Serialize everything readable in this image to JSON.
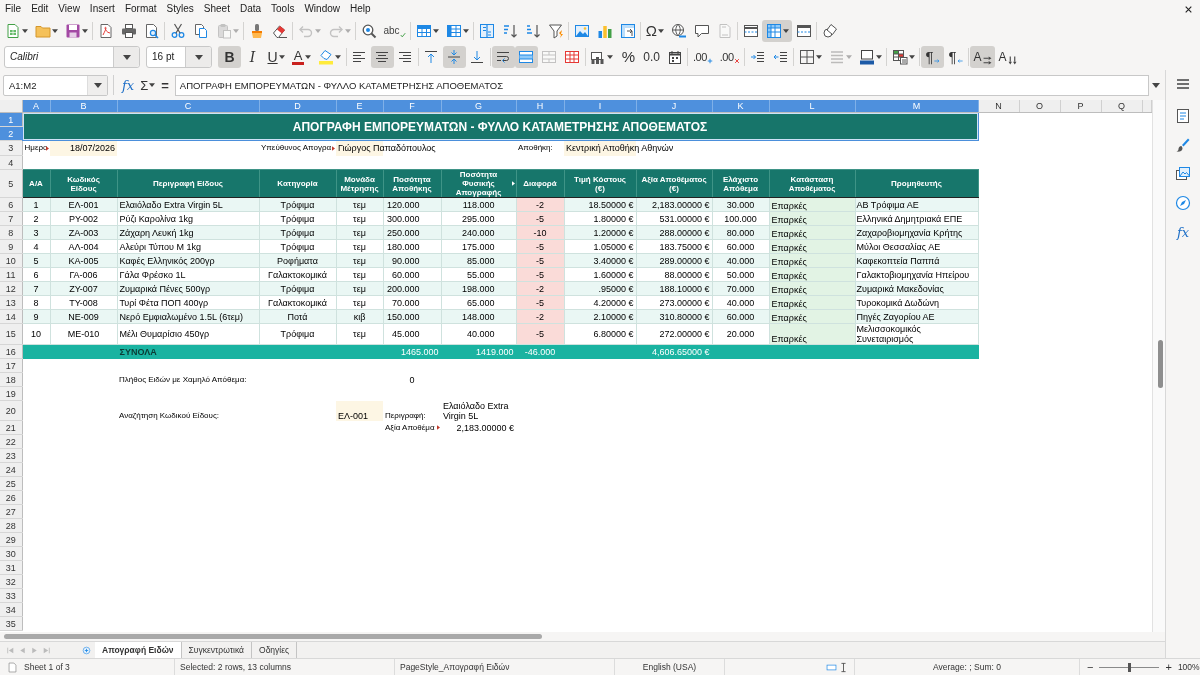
{
  "menu_bar": [
    "File",
    "Edit",
    "View",
    "Insert",
    "Format",
    "Styles",
    "Sheet",
    "Data",
    "Tools",
    "Window",
    "Help"
  ],
  "standard_toolbar": {
    "paste": {
      "disabled": true
    },
    "undo": {
      "disabled": true
    },
    "redo": {
      "disabled": true
    },
    "spelling": {
      "label": "abc"
    },
    "special_character": {
      "label": "Ω"
    },
    "header_footer": {
      "disabled": true
    },
    "freeze_rows_columns": {
      "pressed": true
    }
  },
  "formatting_toolbar": {
    "font_name": "Calibri",
    "font_size": "16 pt",
    "bold": {
      "label": "B",
      "pressed": true
    },
    "italic": {
      "label": "I",
      "pressed": false
    },
    "underline": {
      "label": "U",
      "pressed": false
    },
    "font_color": {
      "label": "A"
    },
    "align_left": {
      "pressed": false
    },
    "align_center": {
      "pressed": true
    },
    "align_right": {
      "pressed": false
    },
    "align_top": {
      "pressed": false
    },
    "align_middle": {
      "pressed": true
    },
    "align_bottom": {
      "pressed": false
    },
    "wrap_text": {
      "pressed": true
    },
    "merge_and_center": {
      "pressed": true
    },
    "merge_cells": {
      "disabled": true
    },
    "percent": {
      "label": "%"
    },
    "number": {
      "label": "0.0"
    },
    "add_decimal": {
      "label": ".00"
    },
    "delete_decimal": {
      "label": ".00"
    },
    "border_style": {
      "disabled": true
    },
    "left_to_right": {
      "label": "¶",
      "pressed": true
    },
    "right_to_left": {
      "label": "¶",
      "pressed": false
    },
    "text_left_to_right": {
      "label": "A",
      "pressed": true
    },
    "text_top_to_bottom": {
      "label": "A",
      "pressed": false
    }
  },
  "formula_bar": {
    "name_box": "A1:M2",
    "function_wizard": "fx",
    "sum": "Σ",
    "formula": "=",
    "content": "ΑΠΟΓΡΑΦΗ ΕΜΠΟΡΕΥΜΑΤΩΝ - ΦΥΛΛΟ ΚΑΤΑΜΕΤΡΗΣΗΣ ΑΠΟΘΕΜΑΤΟΣ"
  },
  "sidebar": {
    "functions": "fx"
  },
  "sheet": {
    "column_headers": [
      {
        "label": "A",
        "selected": true
      },
      {
        "label": "B",
        "selected": true
      },
      {
        "label": "C",
        "selected": true
      },
      {
        "label": "D",
        "selected": true
      },
      {
        "label": "E",
        "selected": true
      },
      {
        "label": "F",
        "selected": true
      },
      {
        "label": "G",
        "selected": true
      },
      {
        "label": "H",
        "selected": true
      },
      {
        "label": "I",
        "selected": true
      },
      {
        "label": "J",
        "selected": true
      },
      {
        "label": "K",
        "selected": true
      },
      {
        "label": "L",
        "selected": true
      },
      {
        "label": "M",
        "selected": true
      },
      {
        "label": "N",
        "selected": false
      },
      {
        "label": "O",
        "selected": false
      },
      {
        "label": "P",
        "selected": false
      },
      {
        "label": "Q",
        "selected": false
      }
    ],
    "row_headers": [
      {
        "label": "1",
        "selected": true
      },
      {
        "label": "2",
        "selected": true
      },
      {
        "label": "3",
        "selected": false
      },
      {
        "label": "4",
        "selected": false
      },
      {
        "label": "5",
        "selected": false
      },
      {
        "label": "6",
        "selected": false
      },
      {
        "label": "7",
        "selected": false
      },
      {
        "label": "8",
        "selected": false
      },
      {
        "label": "9",
        "selected": false
      },
      {
        "label": "10",
        "selected": false
      },
      {
        "label": "11",
        "selected": false
      },
      {
        "label": "12",
        "selected": false
      },
      {
        "label": "13",
        "selected": false
      },
      {
        "label": "14",
        "selected": false
      },
      {
        "label": "15",
        "selected": false
      },
      {
        "label": "16",
        "selected": false
      },
      {
        "label": "17",
        "selected": false
      },
      {
        "label": "18",
        "selected": false
      },
      {
        "label": "19",
        "selected": false
      },
      {
        "label": "20",
        "selected": false
      },
      {
        "label": "21",
        "selected": false
      },
      {
        "label": "22",
        "selected": false
      },
      {
        "label": "23",
        "selected": false
      },
      {
        "label": "24",
        "selected": false
      },
      {
        "label": "25",
        "selected": false
      },
      {
        "label": "26",
        "selected": false
      },
      {
        "label": "27",
        "selected": false
      },
      {
        "label": "28",
        "selected": false
      },
      {
        "label": "29",
        "selected": false
      },
      {
        "label": "30",
        "selected": false
      },
      {
        "label": "31",
        "selected": false
      },
      {
        "label": "32",
        "selected": false
      },
      {
        "label": "33",
        "selected": false
      },
      {
        "label": "34",
        "selected": false
      },
      {
        "label": "35",
        "selected": false
      }
    ],
    "title": "ΑΠΟΓΡΑΦΗ ΕΜΠΟΡΕΥΜΑΤΩΝ - ΦΥΛΛΟ ΚΑΤΑΜΕΤΡΗΣΗΣ ΑΠΟΘΕΜΑΤΟΣ"
  },
  "header_fields": [
    {
      "label": "Ημερο",
      "label_clipped": true,
      "value": "18/07/2026"
    },
    {
      "label": "Υπεύθυνος Απογρα",
      "label_clipped": true,
      "value": "Γιώργος Παπαδόπουλος"
    },
    {
      "label": "Αποθήκη:",
      "label_clipped": false,
      "value": "Κεντρική Αποθήκη Αθηνών"
    }
  ],
  "table": {
    "columns": [
      {
        "header": "A/A"
      },
      {
        "header": "Κωδικός Είδους"
      },
      {
        "header": "Περιγραφή Είδους"
      },
      {
        "header": "Κατηγορία"
      },
      {
        "header": "Μονάδα Μέτρησης"
      },
      {
        "header": "Ποσότητα Αποθήκης"
      },
      {
        "header": "Ποσότητα Φυσικής Απογραφής",
        "clipped": true
      },
      {
        "header": "Διαφορά",
        "color": "#fadbd8"
      },
      {
        "header": "Τιμή Κόστους (€)"
      },
      {
        "header": "Αξία Αποθέματος (€)"
      },
      {
        "header": "Ελάχιστο Απόθεμα"
      },
      {
        "header": "Κατάσταση Αποθέματος",
        "color": "#e2f3e4"
      },
      {
        "header": "Προμηθευτής"
      }
    ],
    "rows": [
      [
        "1",
        "ΕΛ-001",
        "Ελαιόλαδο Extra Virgin 5L",
        "Τρόφιμα",
        "τεμ",
        "120.000",
        "118.000",
        "-2",
        "18.50000 €",
        "2,183.00000 €",
        "30.000",
        "Επαρκές",
        "ΑΒ Τρόφιμα ΑΕ"
      ],
      [
        "2",
        "ΡΥ-002",
        "Ρύζι Καρολίνα 1kg",
        "Τρόφιμα",
        "τεμ",
        "300.000",
        "295.000",
        "-5",
        "1.80000 €",
        "531.00000 €",
        "100.000",
        "Επαρκές",
        "Ελληνικά Δημητριακά ΕΠΕ"
      ],
      [
        "3",
        "ΖΑ-003",
        "Ζάχαρη Λευκή 1kg",
        "Τρόφιμα",
        "τεμ",
        "250.000",
        "240.000",
        "-10",
        "1.20000 €",
        "288.00000 €",
        "80.000",
        "Επαρκές",
        "Ζαχαροβιομηχανία Κρήτης"
      ],
      [
        "4",
        "ΑΛ-004",
        "Αλεύρι Τύπου Μ 1kg",
        "Τρόφιμα",
        "τεμ",
        "180.000",
        "175.000",
        "-5",
        "1.05000 €",
        "183.75000 €",
        "60.000",
        "Επαρκές",
        "Μύλοι Θεσσαλίας ΑΕ"
      ],
      [
        "5",
        "ΚΑ-005",
        "Καφές Ελληνικός 200γρ",
        "Ροφήματα",
        "τεμ",
        "90.000",
        "85.000",
        "-5",
        "3.40000 €",
        "289.00000 €",
        "40.000",
        "Επαρκές",
        "Καφεκοπτεία Παππά"
      ],
      [
        "6",
        "ΓΑ-006",
        "Γάλα Φρέσκο 1L",
        "Γαλακτοκομικά",
        "τεμ",
        "60.000",
        "55.000",
        "-5",
        "1.60000 €",
        "88.00000 €",
        "50.000",
        "Επαρκές",
        "Γαλακτοβιομηχανία Ηπείρου"
      ],
      [
        "7",
        "ΖΥ-007",
        "Ζυμαρικά Πένες 500γρ",
        "Τρόφιμα",
        "τεμ",
        "200.000",
        "198.000",
        "-2",
        ".95000 €",
        "188.10000 €",
        "70.000",
        "Επαρκές",
        "Ζυμαρικά Μακεδονίας"
      ],
      [
        "8",
        "ΤΥ-008",
        "Τυρί Φέτα ΠΟΠ 400γρ",
        "Γαλακτοκομικά",
        "τεμ",
        "70.000",
        "65.000",
        "-5",
        "4.20000 €",
        "273.00000 €",
        "40.000",
        "Επαρκές",
        "Τυροκομικά Δωδώνη"
      ],
      [
        "9",
        "ΝΕ-009",
        "Νερό Εμφιαλωμένο 1.5L (6τεμ)",
        "Ποτά",
        "κιβ",
        "150.000",
        "148.000",
        "-2",
        "2.10000 €",
        "310.80000 €",
        "60.000",
        "Επαρκές",
        "Πηγές Ζαγορίου ΑΕ"
      ],
      [
        "10",
        "ΜΕ-010",
        "Μέλι Θυμαρίσιο 450γρ",
        "Τρόφιμα",
        "τεμ",
        "45.000",
        "40.000",
        "-5",
        "6.80000 €",
        "272.00000 €",
        "20.000",
        "Επαρκές",
        "Μελισσοκομικός Συνεταιρισμός"
      ]
    ],
    "totals": {
      "label": "ΣΥΝΟΛΑ",
      "stock_quantity": "1465.000",
      "physical_quantity": "1419.000",
      "difference": "-46.000",
      "stock_value": "4,606.65000 €"
    }
  },
  "low_stock": {
    "label": "Πλήθος Ειδών με Χαμηλό Απόθεμα:",
    "value": "0"
  },
  "lookup": {
    "label": "Αναζήτηση Κωδικού Είδους:",
    "code": "ΕΛ-001",
    "description_label": "Περιγραφή:",
    "description": "Ελαιόλαδο Extra Virgin 5L",
    "value_label": "Αξία Αποθέμα",
    "value_label_clipped": true,
    "value": "2,183.00000 €"
  },
  "sheet_tabs": [
    {
      "label": "Απογραφή Ειδών",
      "selected": true
    },
    {
      "label": "Συγκεντρωτικά",
      "selected": false
    },
    {
      "label": "Οδηγίες",
      "selected": false
    }
  ],
  "status_bar": {
    "sheet": "Sheet 1 of 3",
    "selection": "Selected: 2 rows, 13 columns",
    "page_style": "PageStyle_Απογραφή Ειδών",
    "language": "English (USA)",
    "summary": "Average: ; Sum: 0",
    "zoom_out": "−",
    "zoom": {
      "level": 0.5
    },
    "zoom_in": "+",
    "zoom_value": "100%"
  }
}
